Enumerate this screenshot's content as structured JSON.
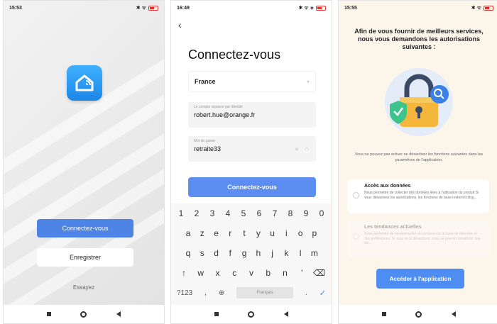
{
  "screen1": {
    "status_time": "15:53",
    "status_icons": "✱ ᯤ",
    "login_label": "Connectez-vous",
    "register_label": "Enregistrer",
    "try_label": "Essayez"
  },
  "screen2": {
    "status_time": "16:49",
    "status_icons": "✱ ᯤ ◈",
    "title": "Connectez-vous",
    "country": "France",
    "email_label": "Le compte repasse par Identité",
    "email_value": "robert.hue@orange.fr",
    "password_label": "Mot de passe",
    "password_value": "retraite33",
    "login_button": "Connectez-vous",
    "keyboard": {
      "row1": [
        "1",
        "2",
        "3",
        "4",
        "5",
        "6",
        "7",
        "8",
        "9",
        "0"
      ],
      "row2": [
        "a",
        "z",
        "e",
        "r",
        "t",
        "y",
        "u",
        "i",
        "o",
        "p"
      ],
      "row3": [
        "q",
        "s",
        "d",
        "f",
        "g",
        "h",
        "j",
        "k",
        "l",
        "m"
      ],
      "row4": [
        "↑",
        "w",
        "x",
        "c",
        "v",
        "b",
        "n",
        "'",
        "⌫"
      ],
      "row5_left": "?123",
      "row5_comma": ",",
      "row5_globe": "⊕",
      "space_label": "Français",
      "row5_period": ".",
      "enter": "✓"
    }
  },
  "screen3": {
    "status_time": "15:55",
    "status_icons": "✱ ᯤ",
    "heading": "Afin de vous fournir de meilleurs services, nous vous demandons les autorisations suivantes :",
    "info_text": "Vous ne pouvez pas activer ou désactiver les fonctions suivantes dans les paramètres de l'application.",
    "card1_title": "Accès aux données",
    "card1_desc": "Nous permettre de collecter des données liées à l'utilisation du produit Si vous désactivez les autorisations, les fonctions de base resteront disp...",
    "card2_title": "Les tendances actuelles",
    "card2_desc": "Nous permettre de recommander du contenu sur la base de données et des préférences. Si vous ne le désactivez, vous ne pourrez bénéficier des ser...",
    "access_button": "Accéder à l'application"
  },
  "colors": {
    "primary": "#4e84e6",
    "logo_blue": "#1c86e8",
    "lock_yellow": "#f4b73b",
    "shield_green": "#3cc48a"
  }
}
